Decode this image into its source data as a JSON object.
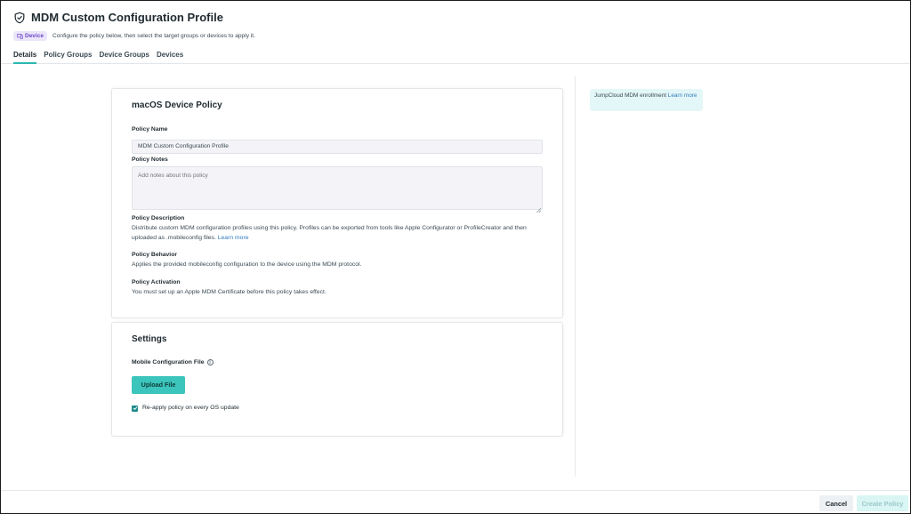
{
  "header": {
    "title": "MDM Custom Configuration Profile",
    "badge": "Device",
    "subtitle": "Configure the policy below, then select the target groups or devices to apply it."
  },
  "tabs": [
    {
      "label": "Details",
      "active": true
    },
    {
      "label": "Policy Groups",
      "active": false
    },
    {
      "label": "Device Groups",
      "active": false
    },
    {
      "label": "Devices",
      "active": false
    }
  ],
  "policy_card": {
    "heading": "macOS Device Policy",
    "name_label": "Policy Name",
    "name_value": "MDM Custom Configuration Profile",
    "notes_label": "Policy Notes",
    "notes_placeholder": "Add notes about this policy",
    "description_label": "Policy Description",
    "description_text": "Distribute custom MDM configuration profiles using this policy. Profiles can be exported from tools like Apple Configurator or ProfileCreator and then uploaded as .mobileconfig files.",
    "description_link": "Learn more",
    "behavior_label": "Policy Behavior",
    "behavior_text": "Applies the provided mobileconfig configuration to the device using the MDM protocol.",
    "activation_label": "Policy Activation",
    "activation_text": "You must set up an Apple MDM Certificate before this policy takes effect."
  },
  "settings_card": {
    "heading": "Settings",
    "file_label": "Mobile Configuration File",
    "upload_label": "Upload File",
    "reapply_label": "Re-apply policy on every OS update",
    "reapply_checked": true
  },
  "info_box": {
    "text": "JumpCloud MDM enrollment",
    "link": "Learn more"
  },
  "footer": {
    "cancel_label": "Cancel",
    "create_label": "Create Policy"
  },
  "colors": {
    "accent": "#3cc5bc",
    "badge_bg": "#ece6fb",
    "badge_text": "#6b48c8",
    "link": "#2f7bc0"
  }
}
